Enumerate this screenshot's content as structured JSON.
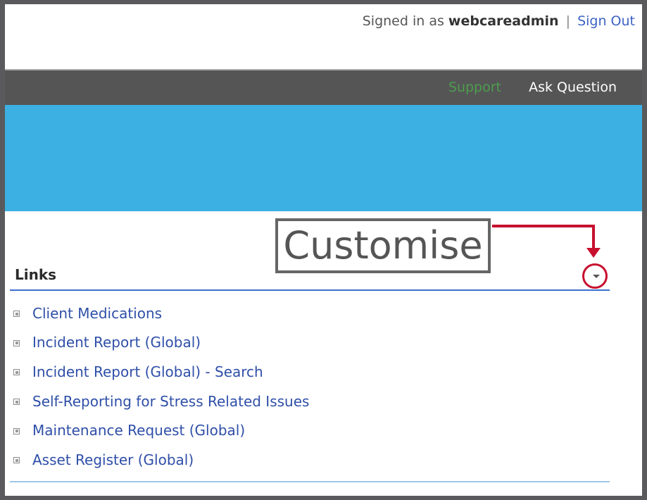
{
  "header": {
    "signed_in_prefix": "Signed in as",
    "username": "webcareadmin",
    "separator": "|",
    "sign_out_label": "Sign Out"
  },
  "nav": {
    "support_label": "Support",
    "ask_question_label": "Ask Question"
  },
  "callout": {
    "text": "Customise"
  },
  "links": {
    "title": "Links",
    "items": [
      {
        "label": "Client Medications"
      },
      {
        "label": "Incident Report (Global)"
      },
      {
        "label": "Incident Report (Global) - Search"
      },
      {
        "label": "Self-Reporting for Stress Related Issues"
      },
      {
        "label": "Maintenance Request (Global)"
      },
      {
        "label": "Asset Register (Global)"
      }
    ]
  },
  "colors": {
    "banner": "#3cb0e3",
    "nav_bg": "#555556",
    "link": "#2f4fa8",
    "callout_accent": "#c8102e",
    "support_text": "#4d9e4d"
  },
  "icons": {
    "dropdown": "chevron-down-icon",
    "bullet": "square-bullet-icon",
    "annotation_arrow": "arrow-icon"
  }
}
